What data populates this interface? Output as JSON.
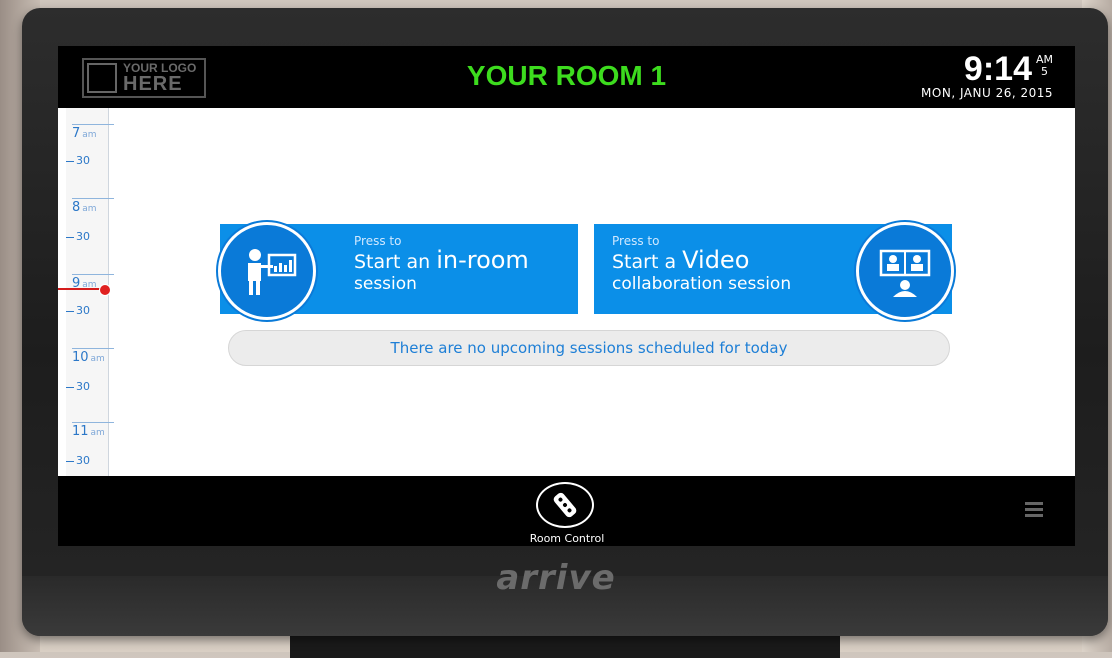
{
  "logo": {
    "line1": "YOUR LOGO",
    "line2": "HERE"
  },
  "header": {
    "room_title": "YOUR ROOM 1",
    "time": "9:14",
    "ampm": "AM",
    "ampm_sub": "5",
    "date": "MON, JANU 26, 2015"
  },
  "timeline": {
    "hours": [
      {
        "hour": "7",
        "suffix": "am",
        "half": "30"
      },
      {
        "hour": "8",
        "suffix": "am",
        "half": "30"
      },
      {
        "hour": "9",
        "suffix": "am",
        "half": "30"
      },
      {
        "hour": "10",
        "suffix": "am",
        "half": "30"
      },
      {
        "hour": "11",
        "suffix": "am",
        "half": "30"
      }
    ]
  },
  "actions": {
    "in_room": {
      "press": "Press to",
      "line2a": "Start an ",
      "line2b": "in-room",
      "line3": "session"
    },
    "video": {
      "press": "Press to",
      "line2a": "Start a ",
      "line2b": "Video",
      "line3": "collaboration session"
    }
  },
  "notice": "There are no upcoming sessions scheduled for today",
  "footer": {
    "room_control_label": "Room Control"
  },
  "device_brand": "arrive",
  "colors": {
    "title_green": "#3ddc1e",
    "accent_blue": "#0b8fe8",
    "now_red": "#d41c1c"
  }
}
